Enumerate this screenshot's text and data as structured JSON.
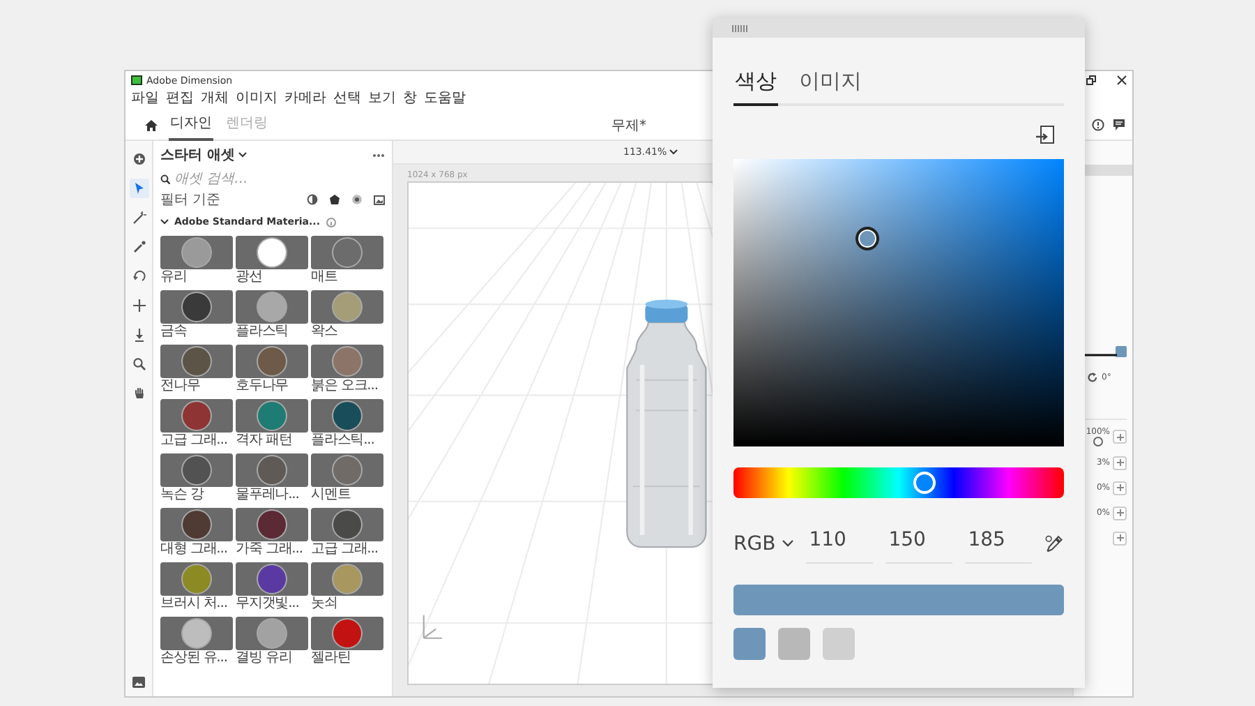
{
  "window": {
    "title": "Adobe Dimension"
  },
  "menu": [
    "파일",
    "편집",
    "개체",
    "이미지",
    "카메라",
    "선택",
    "보기",
    "창",
    "도움말"
  ],
  "mode_tabs": [
    {
      "label": "디자인",
      "selected": true
    },
    {
      "label": "렌더링",
      "selected": false
    }
  ],
  "document_title": "무제*",
  "tools": [
    {
      "kind": "add",
      "selected": false
    },
    {
      "kind": "select",
      "selected": true
    },
    {
      "kind": "wand",
      "selected": false
    },
    {
      "kind": "wand2",
      "selected": false
    },
    {
      "kind": "orbit",
      "selected": false
    },
    {
      "kind": "pan",
      "selected": false
    },
    {
      "kind": "dolly",
      "selected": false
    },
    {
      "kind": "zoom",
      "selected": false
    },
    {
      "kind": "hand",
      "selected": false
    }
  ],
  "assets_panel": {
    "title": "스타터 애셋",
    "search_placeholder": "애셋 검색...",
    "filter_label": "필터 기준",
    "section": "Adobe Standard Materia...",
    "materials": [
      {
        "label": "유리",
        "color": "#9a9a9a"
      },
      {
        "label": "광선",
        "color": "#ffffff"
      },
      {
        "label": "매트",
        "color": "#6c6c6c"
      },
      {
        "label": "금속",
        "color": "#3a3a3a"
      },
      {
        "label": "플라스틱",
        "color": "#a8a8a8"
      },
      {
        "label": "왁스",
        "color": "#a59d78"
      },
      {
        "label": "전나무",
        "color": "#5c5446"
      },
      {
        "label": "호두나무",
        "color": "#6e5a48"
      },
      {
        "label": "붉은 오크...",
        "color": "#8c7468"
      },
      {
        "label": "고급 그래...",
        "color": "#8e3434"
      },
      {
        "label": "격자 패턴",
        "color": "#1f7c74"
      },
      {
        "label": "플라스틱...",
        "color": "#1a4d5a"
      },
      {
        "label": "녹슨 강",
        "color": "#525252"
      },
      {
        "label": "물푸레나...",
        "color": "#5f5a55"
      },
      {
        "label": "시멘트",
        "color": "#706b67"
      },
      {
        "label": "대형 그래...",
        "color": "#4f3a34"
      },
      {
        "label": "가죽 그래...",
        "color": "#5b2a35"
      },
      {
        "label": "고급 그래...",
        "color": "#4a4a48"
      },
      {
        "label": "브러시 처...",
        "color": "#8c8a22"
      },
      {
        "label": "무지갯빛...",
        "color": "#5a3aa2"
      },
      {
        "label": "놋쇠",
        "color": "#a89860"
      },
      {
        "label": "손상된 유...",
        "color": "#bdbdbd"
      },
      {
        "label": "결빙 유리",
        "color": "#a2a2a2"
      },
      {
        "label": "젤라틴",
        "color": "#c21212"
      }
    ]
  },
  "canvas": {
    "zoom": "113.41%",
    "size": "1024 x 768 px"
  },
  "right_panel": {
    "rotation": "0°",
    "rows": [
      {
        "kind": "knob",
        "value": "100%"
      },
      {
        "kind": "percent",
        "value": "3%"
      },
      {
        "kind": "percent",
        "value": "0%"
      },
      {
        "kind": "percent",
        "value": "0%"
      },
      {
        "kind": "add"
      }
    ]
  },
  "color_picker": {
    "tabs": [
      {
        "label": "색상",
        "selected": true
      },
      {
        "label": "이미지",
        "selected": false
      }
    ],
    "hue": {
      "level": 0.58
    },
    "mode": "RGB",
    "rgb": [
      "110",
      "150",
      "185"
    ],
    "swatches": [
      {
        "color": "#6e96b9"
      },
      {
        "color": "#b8b8b8"
      },
      {
        "color": "#d0d0d0"
      }
    ]
  }
}
